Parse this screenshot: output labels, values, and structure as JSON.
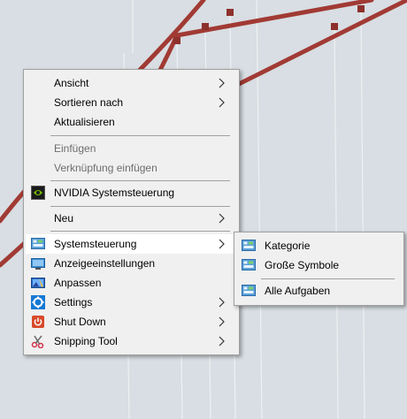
{
  "context_menu": {
    "items": [
      {
        "label": "Ansicht"
      },
      {
        "label": "Sortieren nach"
      },
      {
        "label": "Aktualisieren"
      },
      {
        "label": "Einfügen"
      },
      {
        "label": "Verknüpfung einfügen"
      },
      {
        "label": "NVIDIA Systemsteuerung",
        "icon": "nvidia-icon"
      },
      {
        "label": "Neu"
      },
      {
        "label": "Systemsteuerung",
        "icon": "control-panel-icon"
      },
      {
        "label": "Anzeigeeinstellungen",
        "icon": "display-icon"
      },
      {
        "label": "Anpassen",
        "icon": "personalize-icon"
      },
      {
        "label": "Settings",
        "icon": "gear-icon"
      },
      {
        "label": "Shut Down",
        "icon": "power-icon"
      },
      {
        "label": "Snipping Tool",
        "icon": "scissors-icon"
      }
    ]
  },
  "submenu": {
    "items": [
      {
        "label": "Kategorie",
        "icon": "control-panel-icon"
      },
      {
        "label": "Große Symbole",
        "icon": "control-panel-icon"
      },
      {
        "label": "Alle Aufgaben",
        "icon": "control-panel-icon"
      }
    ]
  },
  "colors": {
    "bridge_cable": "#a13a34",
    "menu_background": "#f0f0f0",
    "highlight": "#ffffff",
    "disabled_text": "#6d6d6d"
  }
}
